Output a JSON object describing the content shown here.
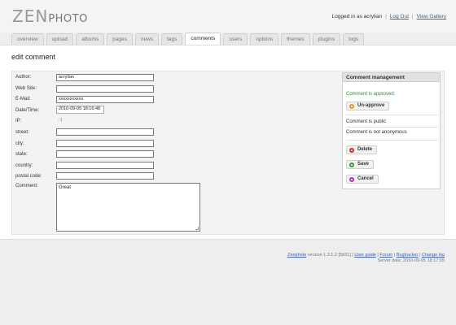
{
  "app": {
    "logo_zen": "ZEN",
    "logo_photo": "PHOTO"
  },
  "userbar": {
    "logged_in": "Logged in as acrylian",
    "logout": "Log Out",
    "view_gallery": "View Gallery"
  },
  "tabs": [
    {
      "label": "overview"
    },
    {
      "label": "upload"
    },
    {
      "label": "albums"
    },
    {
      "label": "pages"
    },
    {
      "label": "news"
    },
    {
      "label": "tags"
    },
    {
      "label": "comments",
      "active": true
    },
    {
      "label": "users"
    },
    {
      "label": "options"
    },
    {
      "label": "themes"
    },
    {
      "label": "plugins"
    },
    {
      "label": "logs"
    }
  ],
  "page": {
    "title": "edit comment"
  },
  "form": {
    "author_label": "Author:",
    "author_value": "acrylian",
    "website_label": "Web Site:",
    "website_value": "",
    "email_label": "E-Mail:",
    "email_value": "xxxxxxxxxxx",
    "datetime_label": "Date/Time:",
    "datetime_value": "2010-09-05 18:16:48",
    "ip_label": "IP:",
    "ip_value": "::1",
    "street_label": "street:",
    "street_value": "",
    "city_label": "city:",
    "city_value": "",
    "state_label": "state:",
    "state_value": "",
    "country_label": "country:",
    "country_value": "",
    "postal_label": "postal code:",
    "postal_value": "",
    "comment_label": "Comment:",
    "comment_value": "Great"
  },
  "management": {
    "title": "Comment management",
    "approved_text": "Comment is approved.",
    "unapprove_label": "Un-approve",
    "public_text": "Comment is public",
    "anon_text": "Comment is not anonymous",
    "delete_label": "Delete",
    "save_label": "Save",
    "cancel_label": "Cancel"
  },
  "footer": {
    "brand": "Zenphoto",
    "version": " version 1.3.1.2 [5831] | ",
    "user_guide": "User guide",
    "sep1": " | ",
    "forum": "Forum",
    "sep2": " | ",
    "bugtracker": "Bugtracker",
    "sep3": " | ",
    "changelog": "Change log",
    "server_date": "Server date: 2010-09-05 18:17:05"
  },
  "icons": {
    "unapprove": "unapprove-icon",
    "delete": "delete-icon",
    "save": "save-icon",
    "cancel": "cancel-icon"
  },
  "colors": {
    "link": "#3d63a6",
    "approved": "#2e8b2e",
    "delete": "#c8352d",
    "save": "#3b9a3b",
    "cancel": "#b03aa5",
    "unapprove": "#e59b23"
  }
}
